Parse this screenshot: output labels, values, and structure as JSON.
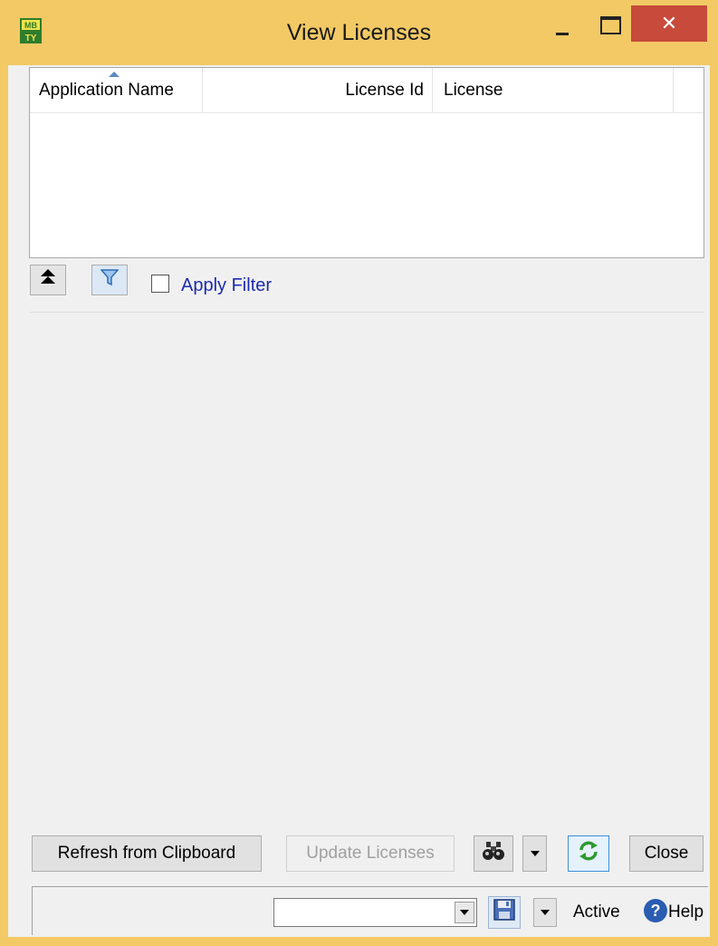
{
  "window": {
    "title": "View Licenses",
    "close_glyph": "✕",
    "accent_color": "#f2c965",
    "icon": "mbty-app-icon"
  },
  "listview": {
    "columns": [
      {
        "label": "Application Name",
        "sorted": "ascending"
      },
      {
        "label": "License Id"
      },
      {
        "label": "License"
      }
    ],
    "rows": []
  },
  "filter": {
    "apply_filter_label": "Apply Filter",
    "apply_filter_checked": false,
    "icons": [
      "collapse-top-icon",
      "filter-funnel-icon"
    ]
  },
  "buttons": {
    "refresh_label": "Refresh from Clipboard",
    "update_label": "Update Licenses",
    "update_enabled": false,
    "close_label": "Close",
    "find_icon": "binoculars-icon",
    "reload_icon": "refresh-arrows-icon"
  },
  "statusbar": {
    "combo_value": "",
    "active_label": "Active",
    "help_label": "Help",
    "help_glyph": "?",
    "save_icon": "floppy-save-icon"
  }
}
